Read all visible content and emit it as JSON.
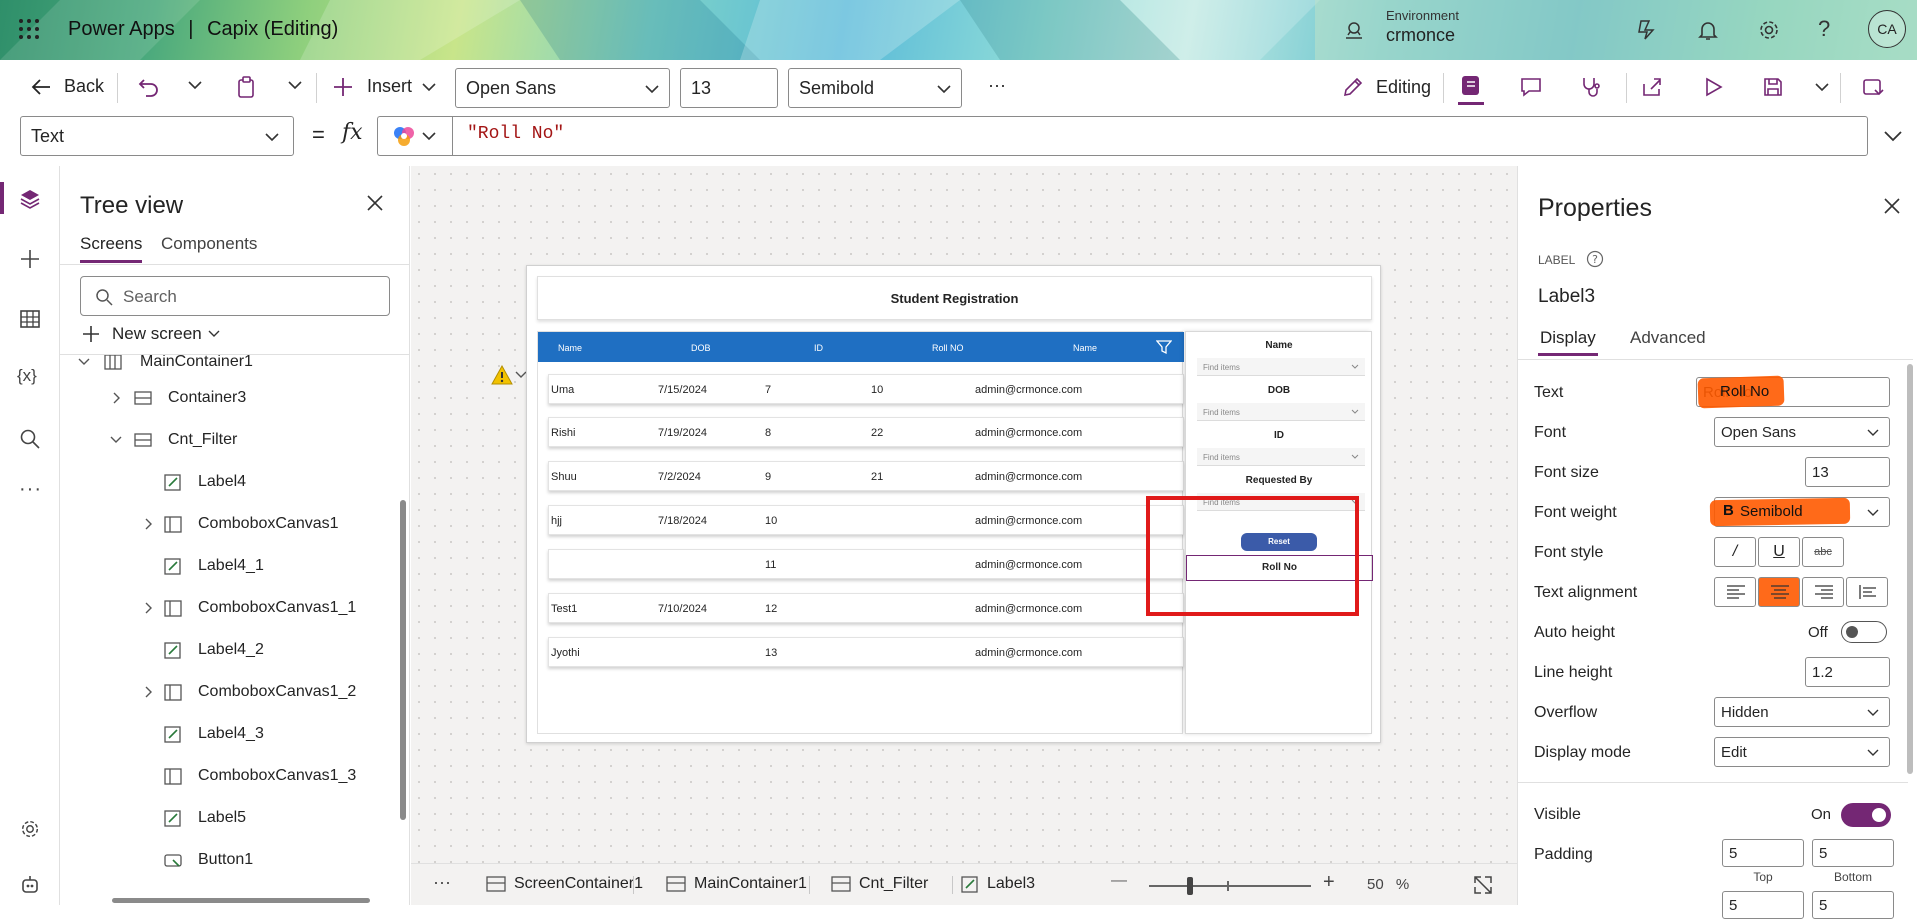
{
  "header": {
    "app_name": "Power Apps",
    "separator": "|",
    "doc_title": "Capix (Editing)",
    "env_label": "Environment",
    "env_name": "crmonce",
    "avatar": "CA",
    "icons": [
      "app-launcher-icon",
      "environment-icon",
      "copilot-icon",
      "bell-icon",
      "gear-icon",
      "help-icon"
    ]
  },
  "toolbar": {
    "back": "Back",
    "insert": "Insert",
    "font": "Open Sans",
    "font_size": "13",
    "font_weight": "Semibold",
    "more": "···",
    "editing": "Editing"
  },
  "formula": {
    "property": "Text",
    "equals": "=",
    "fx": "fx",
    "value": "\"Roll No\""
  },
  "tree": {
    "title": "Tree view",
    "tabs": [
      "Screens",
      "Components"
    ],
    "search_placeholder": "Search",
    "new_screen": "New screen",
    "items": [
      {
        "label": "MainContainer1"
      },
      {
        "label": "Container3"
      },
      {
        "label": "Cnt_Filter"
      },
      {
        "label": "Label4"
      },
      {
        "label": "ComboboxCanvas1"
      },
      {
        "label": "Label4_1"
      },
      {
        "label": "ComboboxCanvas1_1"
      },
      {
        "label": "Label4_2"
      },
      {
        "label": "ComboboxCanvas1_2"
      },
      {
        "label": "Label4_3"
      },
      {
        "label": "ComboboxCanvas1_3"
      },
      {
        "label": "Label5"
      },
      {
        "label": "Button1"
      }
    ]
  },
  "app": {
    "title": "Student Registration",
    "columns": [
      "Name",
      "DOB",
      "ID",
      "Roll NO",
      "Name"
    ],
    "rows": [
      [
        "Uma",
        "7/15/2024",
        "7",
        "10",
        "admin@crmonce.com"
      ],
      [
        "Rishi",
        "7/19/2024",
        "8",
        "22",
        "admin@crmonce.com"
      ],
      [
        "Shuu",
        "7/2/2024",
        "9",
        "21",
        "admin@crmonce.com"
      ],
      [
        "hjj",
        "7/18/2024",
        "10",
        "",
        "admin@crmonce.com"
      ],
      [
        "",
        "",
        "11",
        "",
        "admin@crmonce.com"
      ],
      [
        "Test1",
        "7/10/2024",
        "12",
        "",
        "admin@crmonce.com"
      ],
      [
        "Jyothi",
        "",
        "13",
        "",
        "admin@crmonce.com"
      ]
    ],
    "filter": {
      "labels": [
        "Name",
        "DOB",
        "ID",
        "Requested By"
      ],
      "placeholder": "Find items",
      "reset": "Reset",
      "selected_label": "Roll No"
    }
  },
  "statusbar": {
    "more": "···",
    "crumbs": [
      "ScreenContainer1",
      "MainContainer1",
      "Cnt_Filter",
      "Label3"
    ],
    "zoom_minus": "—",
    "zoom_plus": "+",
    "zoom": "50",
    "zoom_unit": "%",
    "zoom_percent": 50
  },
  "props": {
    "title": "Properties",
    "type": "LABEL",
    "name": "Label3",
    "tabs": [
      "Display",
      "Advanced"
    ],
    "text_label": "Text",
    "text_value": "Roll No",
    "font_label": "Font",
    "font_value": "Open Sans",
    "font_size_label": "Font size",
    "font_size_value": "13",
    "font_weight_label": "Font weight",
    "font_weight_value": "Semibold",
    "font_style_label": "Font style",
    "text_align_label": "Text alignment",
    "auto_height_label": "Auto height",
    "auto_height_value": "Off",
    "line_height_label": "Line height",
    "line_height_value": "1.2",
    "overflow_label": "Overflow",
    "overflow_value": "Hidden",
    "display_mode_label": "Display mode",
    "display_mode_value": "Edit",
    "visible_label": "Visible",
    "visible_value": "On",
    "padding_label": "Padding",
    "padding_top": "5",
    "padding_bottom": "5",
    "top_label": "Top",
    "bottom_label": "Bottom",
    "padding_left": "5",
    "padding_right": "5"
  },
  "colors": {
    "accent": "#742774",
    "grid_header": "#1f6fc2",
    "reset_button": "#3b5ba9",
    "highlight": "#ff5a00",
    "annotation": "#e01a1a"
  }
}
